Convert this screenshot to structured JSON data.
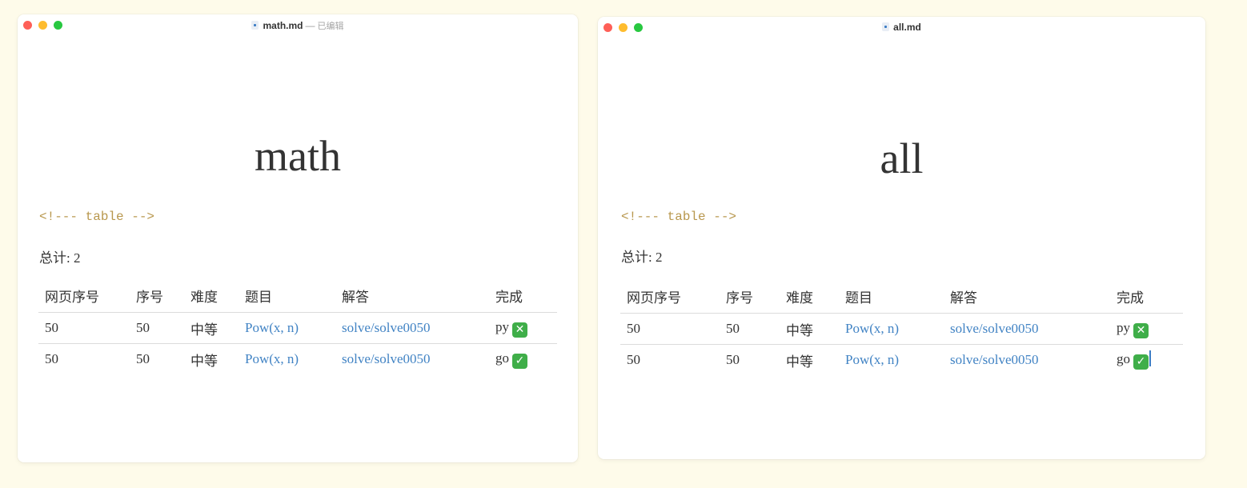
{
  "windows": [
    {
      "filename": "math.md",
      "separator": "—",
      "status": "已编辑",
      "heading": "math",
      "comment": "<!--- table -->",
      "total": "总计: 2",
      "columns": [
        "网页序号",
        "序号",
        "难度",
        "题目",
        "解答",
        "完成"
      ],
      "rows": [
        {
          "page_no": "50",
          "no": "50",
          "difficulty": "中等",
          "problem": "Pow(x, n)",
          "solution": "solve/solve0050",
          "lang": "py",
          "done_icon": "cross-mark-button-icon",
          "done_glyph": "✕"
        },
        {
          "page_no": "50",
          "no": "50",
          "difficulty": "中等",
          "problem": "Pow(x, n)",
          "solution": "solve/solve0050",
          "lang": "go",
          "done_icon": "check-mark-button-icon",
          "done_glyph": "✓"
        }
      ]
    },
    {
      "filename": "all.md",
      "heading": "all",
      "comment": "<!--- table -->",
      "total": "总计: 2",
      "columns": [
        "网页序号",
        "序号",
        "难度",
        "题目",
        "解答",
        "完成"
      ],
      "rows": [
        {
          "page_no": "50",
          "no": "50",
          "difficulty": "中等",
          "problem": "Pow(x, n)",
          "solution": "solve/solve0050",
          "lang": "py",
          "done_icon": "cross-mark-button-icon",
          "done_glyph": "✕"
        },
        {
          "page_no": "50",
          "no": "50",
          "difficulty": "中等",
          "problem": "Pow(x, n)",
          "solution": "solve/solve0050",
          "lang": "go",
          "done_icon": "check-mark-button-icon",
          "done_glyph": "✓"
        }
      ]
    }
  ],
  "colors": {
    "background": "#fefbea",
    "link": "#4183c4",
    "comment": "#b8974d",
    "emoji_green": "#3fae49",
    "close": "#fe5f57",
    "minimize": "#febc2e",
    "zoom": "#28c840"
  }
}
